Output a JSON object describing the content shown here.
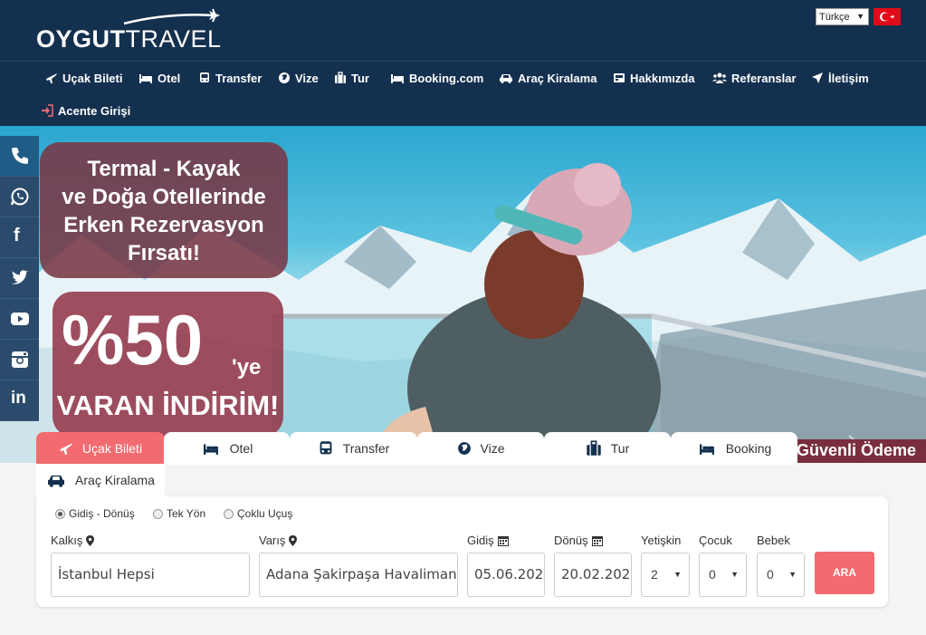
{
  "header": {
    "logo_main": "OYGUT",
    "logo_sub": "TRAVEL",
    "language": "Türkçe"
  },
  "nav": [
    {
      "label": "Uçak Bileti",
      "icon": "plane-icon"
    },
    {
      "label": "Otel",
      "icon": "bed-icon"
    },
    {
      "label": "Transfer",
      "icon": "bus-icon"
    },
    {
      "label": "Vize",
      "icon": "globe-icon"
    },
    {
      "label": "Tur",
      "icon": "suitcase-icon"
    },
    {
      "label": "Booking.com",
      "icon": "bed-icon"
    },
    {
      "label": "Araç Kiralama",
      "icon": "car-icon"
    },
    {
      "label": "Hakkımızda",
      "icon": "id-card-icon"
    },
    {
      "label": "Referanslar",
      "icon": "users-icon"
    },
    {
      "label": "İletişim",
      "icon": "send-icon"
    },
    {
      "label": "Acente Girişi",
      "icon": "sign-in-icon"
    }
  ],
  "hero": {
    "promo_line1": "Termal - Kayak",
    "promo_line2": "ve Doğa Otellerinde",
    "promo_line3": "Erken Rezervasyon",
    "promo_line4": "Fırsatı!",
    "discount": "%50",
    "discount_suffix": "'ye",
    "discount_text": "VARAN İNDİRİM!",
    "secure_payment": "Güvenli Ödeme"
  },
  "social": [
    "phone-icon",
    "whatsapp-icon",
    "facebook-icon",
    "twitter-icon",
    "youtube-icon",
    "instagram-icon",
    "linkedin-icon"
  ],
  "tabs": [
    {
      "label": "Uçak Bileti",
      "icon": "plane-icon",
      "active": true
    },
    {
      "label": "Otel",
      "icon": "bed-icon"
    },
    {
      "label": "Transfer",
      "icon": "bus-icon"
    },
    {
      "label": "Vize",
      "icon": "globe-icon"
    },
    {
      "label": "Tur",
      "icon": "suitcase-icon"
    },
    {
      "label": "Booking",
      "icon": "bed-icon"
    },
    {
      "label": "Araç Kiralama",
      "icon": "car-icon"
    }
  ],
  "search": {
    "trip_types": [
      "Gidiş - Dönüş",
      "Tek Yön",
      "Çoklu Uçuş"
    ],
    "from_label": "Kalkış",
    "from_value": "İstanbul Hepsi",
    "to_label": "Varış",
    "to_value": "Adana Şakirpaşa Havalimanı - A",
    "depart_label": "Gidiş",
    "depart_value": "05.06.202",
    "return_label": "Dönüş",
    "return_value": "20.02.202",
    "adult_label": "Yetişkin",
    "adult_value": "2",
    "child_label": "Çocuk",
    "child_value": "0",
    "infant_label": "Bebek",
    "infant_value": "0",
    "search_button": "ARA"
  },
  "colors": {
    "navy": "#14304f",
    "accent": "#f26b70",
    "promo": "#8a3a4c"
  }
}
